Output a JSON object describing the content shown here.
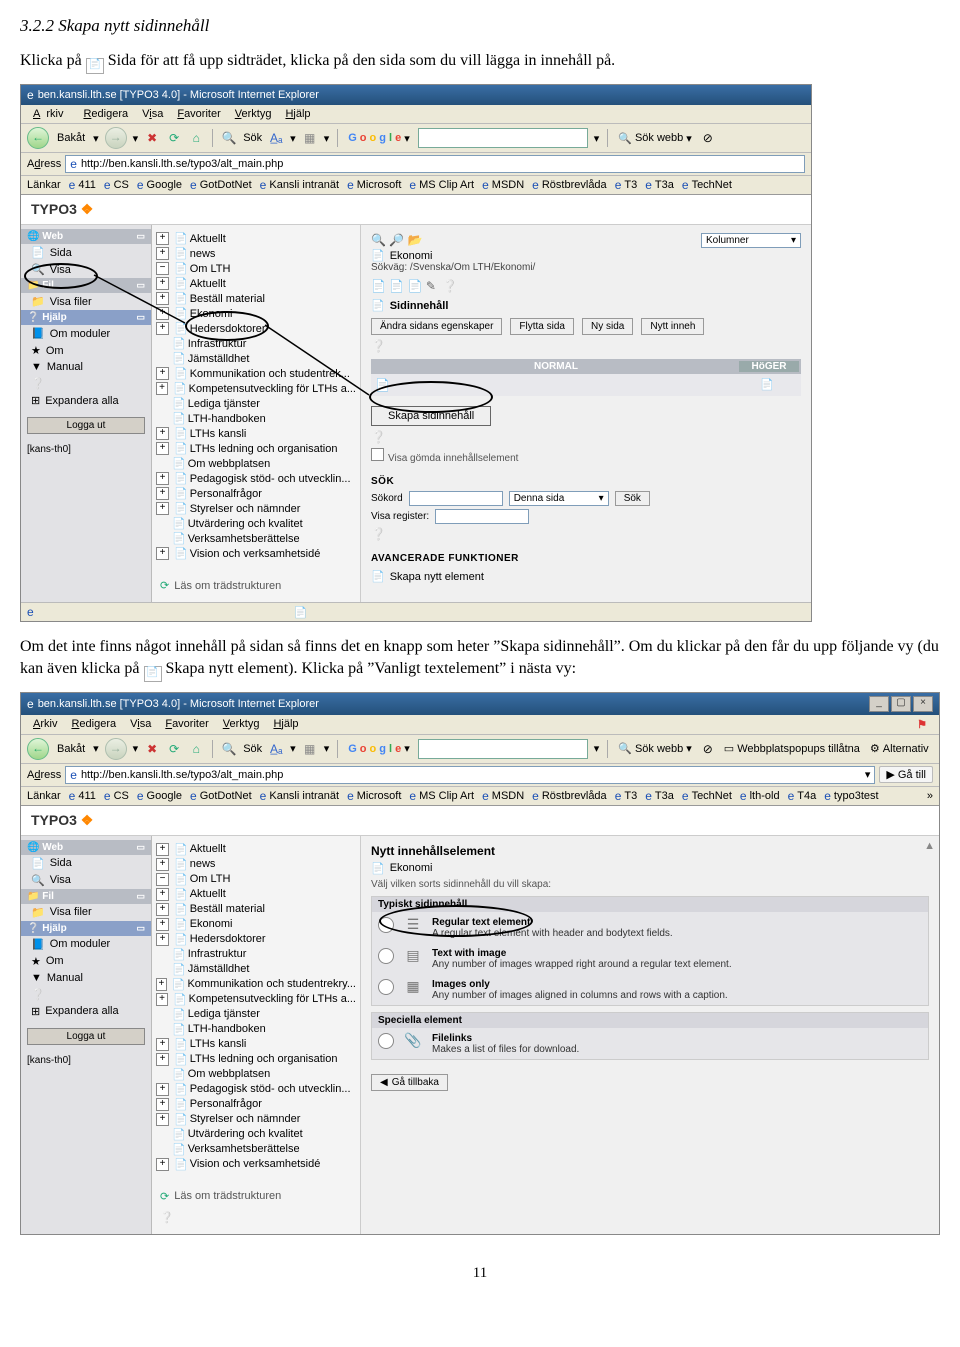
{
  "heading": "3.2.2 Skapa nytt sidinnehåll",
  "intro_pre": "Klicka på ",
  "intro_mid": " Sida för att få upp sidträdet, klicka på den sida som du vill lägga in innehåll på.",
  "para2_pre": "Om det inte finns något innehåll på sidan så finns det en knapp som heter ”Skapa sidinnehåll”. Om du klickar på den får du upp följande vy (du kan även klicka på ",
  "para2_post": " Skapa nytt element). Klicka på ”Vanligt textelement” i nästa vy:",
  "pageNumber": "11",
  "browser": {
    "title": "ben.kansli.lth.se [TYPO3 4.0] - Microsoft Internet Explorer",
    "menus": {
      "arkiv": "Arkiv",
      "redigera": "Redigera",
      "visa": "Visa",
      "favoriter": "Favoriter",
      "verktyg": "Verktyg",
      "hjalp": "Hjälp"
    },
    "toolbar": {
      "back": "Bakåt",
      "search": "Sök",
      "sokwebb": "Sök webb",
      "popups": "Webbplatspopups tillåtna",
      "alternativ": "Alternativ",
      "google": "Google"
    },
    "addressLabel": "Adress",
    "address": "http://ben.kansli.lth.se/typo3/alt_main.php",
    "go": "Gå till",
    "linksLabel": "Länkar",
    "links": [
      "411",
      "CS",
      "Google",
      "GotDotNet",
      "Kansli intranät",
      "Microsoft",
      "MS Clip Art",
      "MSDN",
      "Röstbrevlåda",
      "T3",
      "T3a",
      "TechNet"
    ],
    "links2extra": [
      "lth-old",
      "T4a",
      "typo3test"
    ]
  },
  "typo3": {
    "brand": "TYPO3",
    "navWeb": "Web",
    "navSida": "Sida",
    "navVisa": "Visa",
    "navFil": "Fil",
    "navVisaFiler": "Visa filer",
    "navHjalp": "Hjälp",
    "navOmModuler": "Om moduler",
    "navOm": "Om",
    "navManual": "Manual",
    "navExpandera": "Expandera alla",
    "logout": "Logga ut",
    "user": "[kans-th0]"
  },
  "tree": {
    "items": [
      "Aktuellt",
      "news",
      "Om LTH",
      "Aktuellt",
      "Beställ material",
      "Ekonomi",
      "Hedersdoktorer",
      "Infrastruktur",
      "Jämställdhet",
      "Kommunikation och studentrek...",
      "Kompetensutveckling för LTHs a...",
      "Lediga tjänster",
      "LTH-handboken",
      "LTHs kansli",
      "LTHs ledning och organisation",
      "Om webbplatsen",
      "Pedagogisk stöd- och utvecklin...",
      "Personalfrågor",
      "Styrelser och nämnder",
      "Utvärdering och kvalitet",
      "Verksamhetsberättelse",
      "Vision och verksamhetsidé"
    ],
    "footer": "Läs om trädstrukturen"
  },
  "panel1": {
    "ekonomi": "Ekonomi",
    "path": "Sökväg: /Svenska/Om LTH/Ekonomi/",
    "kolumner": "Kolumner",
    "sidinnehall": "Sidinnehåll",
    "btns": {
      "andra": "Ändra sidans egenskaper",
      "flytta": "Flytta sida",
      "ny": "Ny sida",
      "nytt": "Nytt inneh"
    },
    "normal": "NORMAL",
    "hoger": "HöGER",
    "skapa": "Skapa sidinnehåll",
    "visaGomda": "Visa gömda innehållselement",
    "sok": "SÖK",
    "sokord": "Sökord",
    "dennaSida": "Denna sida",
    "sokBtn": "Sök",
    "visaReg": "Visa register:",
    "adv": "AVANCERADE FUNKTIONER",
    "skapaNytt": "Skapa nytt element"
  },
  "panel2": {
    "title": "Nytt innehållselement",
    "ekonomi": "Ekonomi",
    "prompt": "Välj vilken sorts sidinnehåll du vill skapa:",
    "cat1": "Typiskt sidinnehåll",
    "o1": {
      "t": "Regular text element",
      "d": "A regular text element with header and bodytext fields."
    },
    "o2": {
      "t": "Text with image",
      "d": "Any number of images wrapped right around a regular text element."
    },
    "o3": {
      "t": "Images only",
      "d": "Any number of images aligned in columns and rows with a caption."
    },
    "cat2": "Speciella element",
    "o4": {
      "t": "Filelinks",
      "d": "Makes a list of files for download."
    },
    "back": "Gå tillbaka"
  }
}
